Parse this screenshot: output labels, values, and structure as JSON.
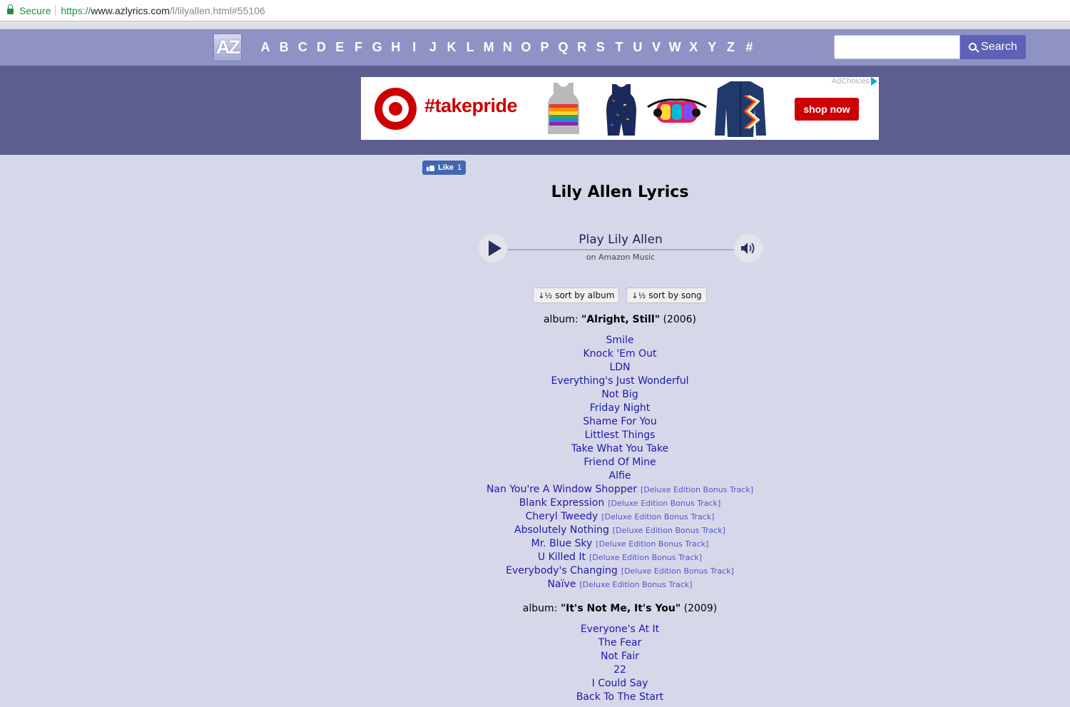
{
  "browser": {
    "secure_label": "Secure",
    "url_scheme": "https://",
    "url_host": "www.azlyrics.com",
    "url_path": "/l/lilyallen.html#55106"
  },
  "nav": {
    "logo": "AZ",
    "letters": [
      "A",
      "B",
      "C",
      "D",
      "E",
      "F",
      "G",
      "H",
      "I",
      "J",
      "K",
      "L",
      "M",
      "N",
      "O",
      "P",
      "Q",
      "R",
      "S",
      "T",
      "U",
      "V",
      "W",
      "X",
      "Y",
      "Z",
      "#"
    ],
    "search_placeholder": "",
    "search_label": "Search"
  },
  "ad": {
    "adchoices": "AdChoices",
    "hashtag": "#takepride",
    "shop_label": "shop now"
  },
  "page": {
    "like_label": "Like",
    "like_count": "1",
    "title": "Lily Allen Lyrics",
    "player_title": "Play Lily Allen",
    "player_sub": "on Amazon Music",
    "sort_album": "sort by album",
    "sort_song": "sort by song",
    "sort_album_icon": "↓½",
    "sort_song_icon": "↓½"
  },
  "albums": [
    {
      "prefix": "album: ",
      "name": "\"Alright, Still\"",
      "year": " (2006)",
      "songs": [
        {
          "title": "Smile",
          "note": ""
        },
        {
          "title": "Knock 'Em Out",
          "note": ""
        },
        {
          "title": "LDN",
          "note": ""
        },
        {
          "title": "Everything's Just Wonderful",
          "note": ""
        },
        {
          "title": "Not Big",
          "note": ""
        },
        {
          "title": "Friday Night",
          "note": ""
        },
        {
          "title": "Shame For You",
          "note": ""
        },
        {
          "title": "Littlest Things",
          "note": ""
        },
        {
          "title": "Take What You Take",
          "note": ""
        },
        {
          "title": "Friend Of Mine",
          "note": ""
        },
        {
          "title": "Alfie",
          "note": ""
        },
        {
          "title": "Nan You're A Window Shopper",
          "note": "[Deluxe Edition Bonus Track]"
        },
        {
          "title": "Blank Expression",
          "note": "[Deluxe Edition Bonus Track]"
        },
        {
          "title": "Cheryl Tweedy",
          "note": "[Deluxe Edition Bonus Track]"
        },
        {
          "title": "Absolutely Nothing",
          "note": "[Deluxe Edition Bonus Track]"
        },
        {
          "title": "Mr. Blue Sky",
          "note": "[Deluxe Edition Bonus Track]"
        },
        {
          "title": "U Killed It",
          "note": "[Deluxe Edition Bonus Track]"
        },
        {
          "title": "Everybody's Changing",
          "note": "[Deluxe Edition Bonus Track]"
        },
        {
          "title": "Naïve",
          "note": "[Deluxe Edition Bonus Track]"
        }
      ]
    },
    {
      "prefix": "album: ",
      "name": "\"It's Not Me, It's You\"",
      "year": " (2009)",
      "songs": [
        {
          "title": "Everyone's At It",
          "note": ""
        },
        {
          "title": "The Fear",
          "note": ""
        },
        {
          "title": "Not Fair",
          "note": ""
        },
        {
          "title": "22",
          "note": ""
        },
        {
          "title": "I Could Say",
          "note": ""
        },
        {
          "title": "Back To The Start",
          "note": ""
        }
      ]
    }
  ],
  "colors": {
    "page_bg": "#d6d8ea",
    "nav_bg": "#8f92c4",
    "ad_band": "#5c5e8f",
    "link": "#1a1aa6",
    "note": "#4f56c9",
    "target_red": "#cc0000"
  }
}
